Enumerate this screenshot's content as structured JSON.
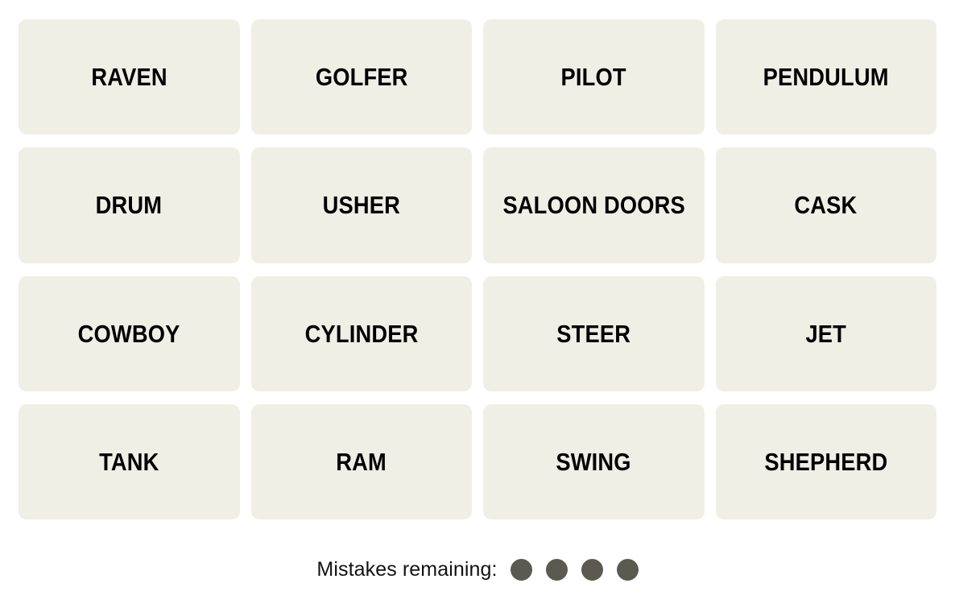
{
  "app": {
    "name": "Connections",
    "background_color": "#ffffff"
  },
  "board": {
    "rows": 4,
    "columns": 4,
    "tile_color": "#efefe6",
    "tile_text_color": "#000000",
    "tiles": [
      {
        "label": "RAVEN",
        "selected": false
      },
      {
        "label": "GOLFER",
        "selected": false
      },
      {
        "label": "PILOT",
        "selected": false
      },
      {
        "label": "PENDULUM",
        "selected": false
      },
      {
        "label": "DRUM",
        "selected": false
      },
      {
        "label": "USHER",
        "selected": false
      },
      {
        "label": "SALOON DOORS",
        "selected": false
      },
      {
        "label": "CASK",
        "selected": false
      },
      {
        "label": "COWBOY",
        "selected": false
      },
      {
        "label": "CYLINDER",
        "selected": false
      },
      {
        "label": "STEER",
        "selected": false
      },
      {
        "label": "JET",
        "selected": false
      },
      {
        "label": "TANK",
        "selected": false
      },
      {
        "label": "RAM",
        "selected": false
      },
      {
        "label": "SWING",
        "selected": false
      },
      {
        "label": "SHEPHERD",
        "selected": false
      }
    ]
  },
  "footer": {
    "mistakes_label": "Mistakes remaining:",
    "mistakes_remaining": 4,
    "dot_color": "#5a5a51"
  }
}
